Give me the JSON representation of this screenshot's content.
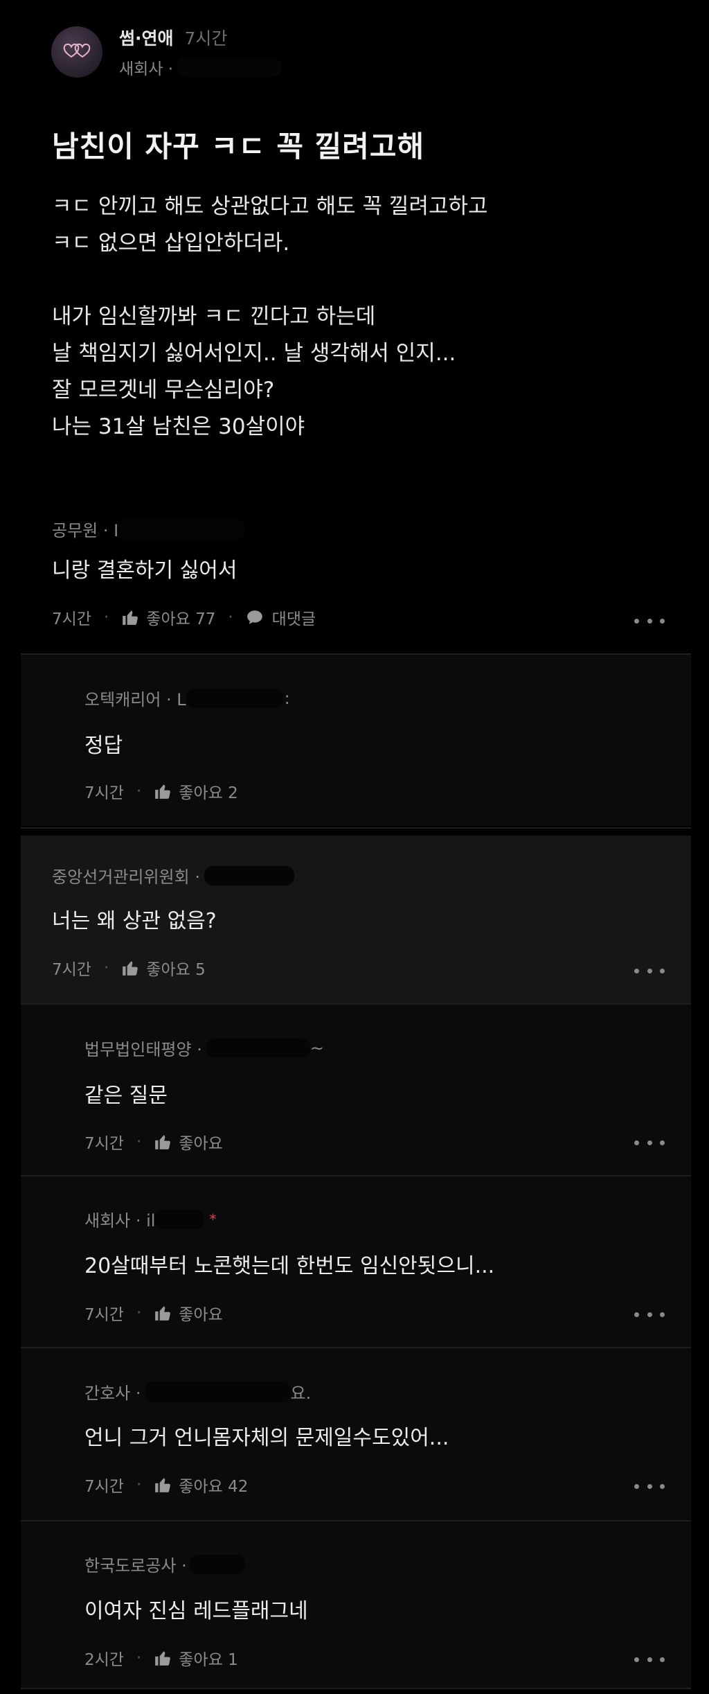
{
  "post": {
    "board": "썸·연애",
    "time": "7시간",
    "company": "새회사 ·",
    "title": "남친이 자꾸 ㅋㄷ 꼭 낄려고해",
    "body": [
      "ㅋㄷ 안끼고 해도 상관없다고 해도 꼭 낄려고하고",
      "ㅋㄷ 없으면 삽입안하더라.",
      "",
      "내가 임신할까봐 ㅋㄷ 낀다고 하는데",
      "날 책임지기 싫어서인지.. 날 생각해서 인지...",
      "잘 모르겟네 무슨심리야?",
      "나는 31살 남친은 30살이야"
    ]
  },
  "comments": [
    {
      "author": "공무원 · I",
      "text": "니랑 결혼하기 싫어서",
      "time": "7시간",
      "likes": "좋아요 77",
      "reply": "대댓글"
    },
    {
      "author": "오텍캐리어 · L",
      "text": "정답",
      "time": "7시간",
      "likes": "좋아요 2"
    },
    {
      "author": "중앙선거관리위원회 ·",
      "text": "너는 왜 상관 없음?",
      "time": "7시간",
      "likes": "좋아요 5"
    },
    {
      "author": "법무법인태평양 ·",
      "author_tail": "~",
      "text": "같은 질문",
      "time": "7시간",
      "likes": "좋아요"
    },
    {
      "author": "새회사 · il",
      "text": "20살때부터 노콘햇는데 한번도 임신안됫으니...",
      "time": "7시간",
      "likes": "좋아요",
      "star": "*"
    },
    {
      "author": "간호사 ·",
      "author_tail": "요.",
      "text": "언니 그거 언니몸자체의 문제일수도있어...",
      "time": "7시간",
      "likes": "좋아요 42"
    },
    {
      "author": "한국도로공사 ·",
      "text": "이여자 진심 레드플래그네",
      "time": "2시간",
      "likes": "좋아요 1"
    }
  ]
}
